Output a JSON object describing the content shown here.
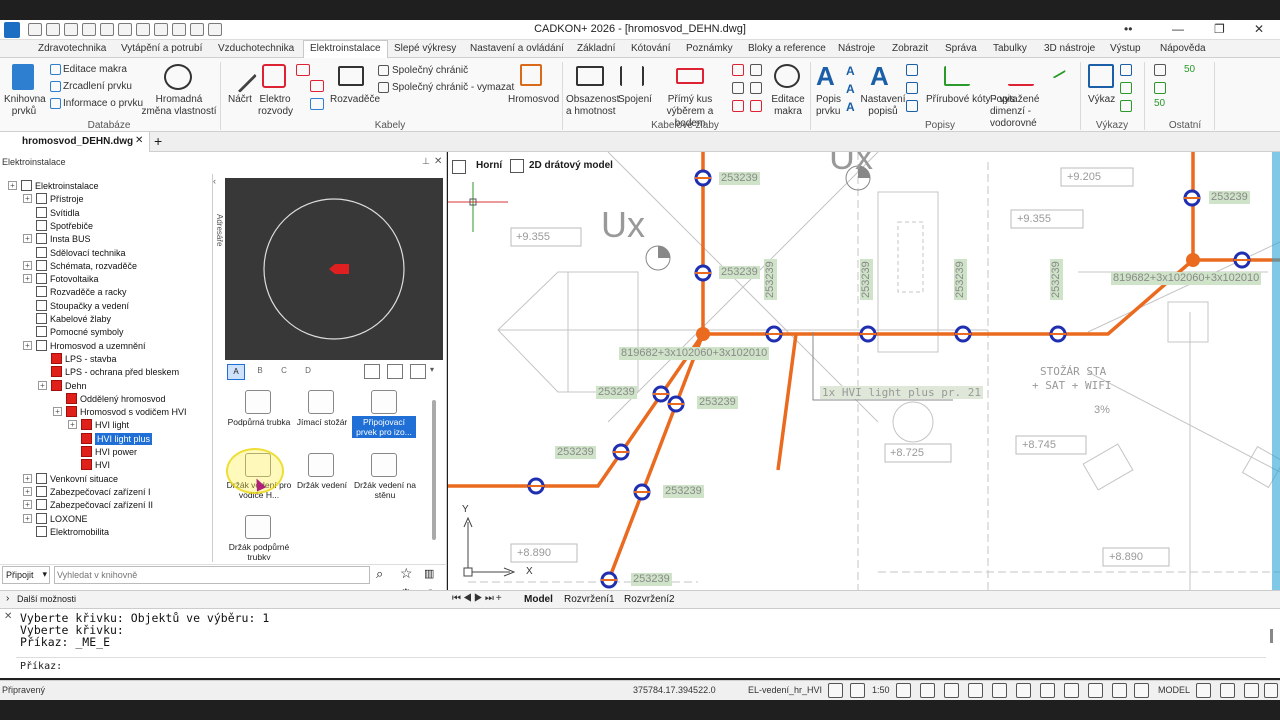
{
  "window": {
    "title": "CADKON+ 2026 - [hromosvod_DEHN.dwg]"
  },
  "ribbon_tabs": [
    "Zdravotechnika",
    "Vytápění a potrubí",
    "Vzduchotechnika",
    "Elektroinstalace",
    "Slepé výkresy",
    "Nastavení a ovládání",
    "Základní",
    "Kótování",
    "Poznámky",
    "Bloky a reference",
    "Nástroje",
    "Zobrazit",
    "Správa",
    "Tabulky",
    "3D nástroje",
    "Výstup",
    "Nápověda"
  ],
  "ribbon": {
    "knihovna": "Knihovna prvků",
    "editace_makra": "Editace makra",
    "zrcadleni": "Zrcadlení prvku",
    "informace": "Informace o prvku",
    "hromadna": "Hromadná změna vlastností",
    "databaze": "Databáze",
    "nacrt": "Náčrt",
    "elektro": "Elektro rozvody",
    "rozvadece": "Rozvaděče",
    "spolecny": "Společný chránič",
    "spolecny_vymazat": "Společný chránič - vymazat",
    "hromosvod": "Hromosvod",
    "kabely": "Kabely",
    "obsazenost": "Obsazenost a hmotnost",
    "spojeni": "Spojení",
    "primy": "Přímý kus výběrem a bodem",
    "editace_makra2": "Editace makra",
    "kabelove": "Kabelové žlaby",
    "popis_prvku": "Popis prvku",
    "nastaveni_popisu": "Nastavení popisů",
    "prirubove": "Přírubové kóty - vytažené",
    "popis_dimenzi": "Popis dimenzí - vodorovné",
    "popisy": "Popisy",
    "vykaz": "Výkaz",
    "vykazy": "Výkazy",
    "ostatni": "Ostatní",
    "v50a": "50",
    "v50b": "50"
  },
  "doc_tab": "hromosvod_DEHN.dwg",
  "panel": {
    "title": "Elektroinstalace",
    "adresare": "Adresáře",
    "tree": [
      "Elektroinstalace",
      "Přístroje",
      "Svítidla",
      "Spotřebiče",
      "Insta BUS",
      "Sdělovací technika",
      "Schémata, rozvaděče",
      "Fotovoltaika",
      "Rozvaděče a racky",
      "Stoupačky a vedení",
      "Kabelové žlaby",
      "Pomocné symboly",
      "Hromosvod a uzemnění",
      "LPS - stavba",
      "LPS - ochrana před bleskem",
      "Dehn",
      "Oddělený hromosvod",
      "Hromosvod s vodičem HVI",
      "HVI light",
      "HVI light plus",
      "HVI power",
      "HVI",
      "Venkovní situace",
      "Zabezpečovací zařízení I",
      "Zabezpečovací zařízení II",
      "LOXONE",
      "Elektromobilita"
    ],
    "filter_tabs": [
      "A",
      "B",
      "C",
      "D"
    ],
    "symbols": [
      "Podpůrná trubka",
      "Jímací stožár",
      "Připojovací prvek pro izo...",
      "Držák vedení pro vodiče H...",
      "Držák vedení",
      "Držák vedení na stěnu",
      "Držák podpůrné trubky"
    ],
    "pripojit": "Připojit",
    "search_placeholder": "Vyhledat v knihovně",
    "dalsi": "Další možnosti"
  },
  "viewport": {
    "view": "Horní",
    "style": "2D drátový model"
  },
  "drawing": {
    "labels": {
      "l1": "253239",
      "l2": "253239",
      "l3": "253239",
      "l4": "253239",
      "l5": "253239",
      "l6": "253239",
      "l7": "253239",
      "v1": "253239",
      "v2": "253239",
      "v3": "253239",
      "v4": "253239",
      "cable1": "819682+3x102060+3x102010",
      "cable2": "819682+3x102060+3x102010",
      "hvi": "1x HVI light plus pr. 21",
      "ux1": "Ux",
      "ux2": "Ux",
      "e1": "+9.355",
      "e2": "+9.205",
      "e3": "+9.355",
      "e4": "+8.745",
      "e5": "+8.725",
      "e6": "+8.890",
      "e7": "+8.890",
      "stozar1": "STOŽÁR STA",
      "stozar2": "+ SAT + WIFI",
      "pct": "3%",
      "axis_x": "X",
      "axis_y": "Y"
    }
  },
  "layout_tabs": [
    "Model",
    "Rozvržení1",
    "Rozvržení2"
  ],
  "command": [
    "Vyberte křivku: Objektů ve výběru: 1",
    "Vyberte křivku:",
    "Příkaz: _ME_E",
    "Příkaz:"
  ],
  "status": {
    "state": "Připravený",
    "coords": "375784.17.394522.0",
    "layer": "EL-vedení_hr_HVI",
    "scale": "1:50",
    "model": "MODEL"
  }
}
